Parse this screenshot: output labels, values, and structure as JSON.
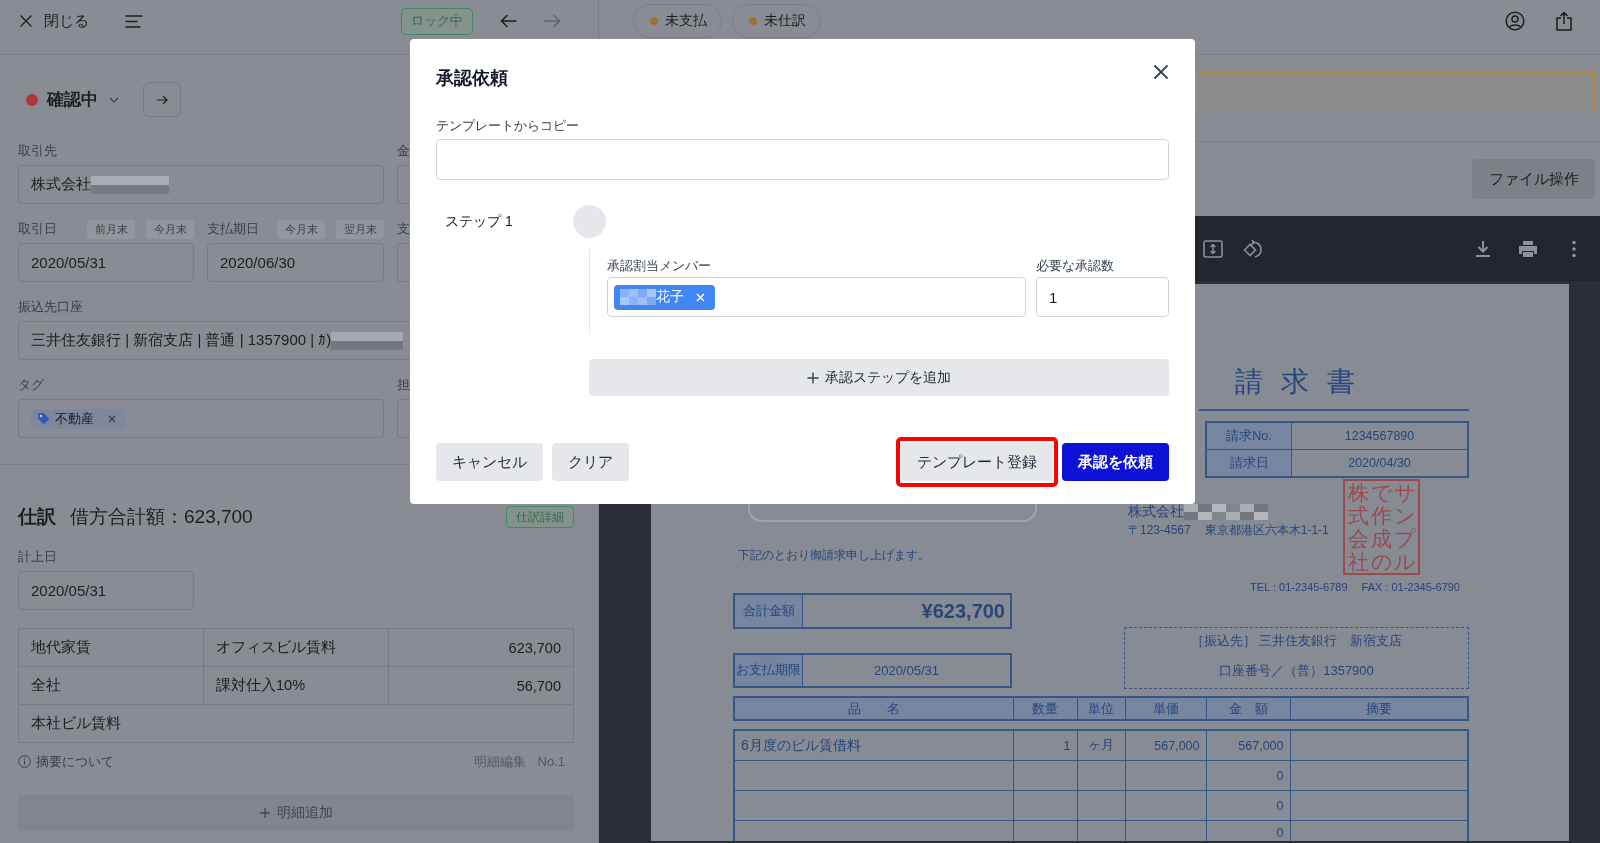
{
  "header": {
    "close_label": "閉じる",
    "lock_badge": "ロック中",
    "navigation": [
      {
        "kind": "back",
        "disabled": false
      },
      {
        "kind": "forward",
        "disabled": true
      }
    ],
    "status_chips": [
      {
        "label": "未支払"
      },
      {
        "label": "未仕訳"
      }
    ]
  },
  "status": {
    "label": "確認中"
  },
  "form": {
    "partner": {
      "label": "取引先",
      "value": "株式会社",
      "redacted": true
    },
    "dates": [
      {
        "label": "取引日",
        "shortcuts": [
          "前月末",
          "今月末"
        ],
        "value": "2020/05/31"
      },
      {
        "label": "支払期日",
        "shortcuts": [
          "今月末",
          "翌月末"
        ],
        "value": "2020/06/30"
      }
    ],
    "bank_account": {
      "label": "振込先口座",
      "value": "三井住友銀行 | 新宿支店 | 普通 | 1357900 | ｶ)",
      "redacted": true
    },
    "tags": {
      "label": "タグ",
      "items": [
        {
          "label": "不動産"
        }
      ]
    },
    "column_2": [
      {
        "label": "金"
      },
      {
        "label": "支"
      },
      {
        "label": "担"
      }
    ]
  },
  "journal": {
    "title": "仕訳",
    "total": "借方合計額：623,700",
    "detail_button": "仕訳詳細",
    "date": {
      "label": "計上日",
      "value": "2020/05/31"
    },
    "lines": [
      [
        "地代家賃",
        "オフィスビル賃料",
        "623,700"
      ],
      [
        "全社",
        "課対仕入10%",
        "56,700"
      ],
      [
        "本社ビル賃料"
      ]
    ],
    "note_link": "摘要について",
    "line_edit": "明細編集",
    "line_no": "No.1",
    "add_line": "明細追加"
  },
  "document": {
    "file_button": "ファイル操作"
  },
  "invoice": {
    "title": "請 求 書",
    "meta": [
      {
        "label": "請求No.",
        "value": "1234567890"
      },
      {
        "label": "請求日",
        "value": "2020/04/30"
      }
    ],
    "issuer": {
      "name": "株式会社",
      "redacted": true,
      "postal": "〒123-4567",
      "address": "東京都港区六本木1-1-1",
      "tel": "TEL : 01-2345-6789",
      "fax": "FAX : 01-2345-6790"
    },
    "stamp": [
      "株式会社",
      "で作成の",
      "サンプル"
    ],
    "message": "下記のとおり御請求申し上げます。",
    "total": {
      "label": "合計金額",
      "value": "¥623,700"
    },
    "due": {
      "label": "お支払期限",
      "value": "2020/05/31"
    },
    "bank": [
      "［振込先］ 三井住友銀行　新宿支店",
      "口座番号／（普）1357900"
    ],
    "columns": [
      "品　　名",
      "数量",
      "単位",
      "単価",
      "金　額",
      "摘要"
    ],
    "items": [
      {
        "name": "6月度のビル賃借料",
        "quantity": "1",
        "unit": "ヶ月",
        "unit_price": "567,000",
        "amount": "567,000"
      },
      {
        "amount": "0"
      },
      {
        "amount": "0"
      },
      {
        "amount": "0"
      }
    ]
  },
  "modal": {
    "title": "承認依頼",
    "template_field": {
      "label": "テンプレートからコピー"
    },
    "steps": [
      {
        "label": "ステップ 1",
        "members_label": "承認割当メンバー",
        "members": [
          {
            "name": "花子",
            "redacted": true
          }
        ],
        "count_label": "必要な承認数",
        "count": "1"
      }
    ],
    "add_step": "承認ステップを追加",
    "footer": {
      "start": [
        {
          "label": "キャンセル",
          "kind": "secondary",
          "highlighted": false
        },
        {
          "label": "クリア",
          "kind": "secondary",
          "highlighted": false
        }
      ],
      "end": [
        {
          "label": "テンプレート登録",
          "kind": "secondary",
          "highlighted": true
        },
        {
          "label": "承認を依頼",
          "kind": "primary",
          "highlighted": false
        }
      ]
    }
  }
}
